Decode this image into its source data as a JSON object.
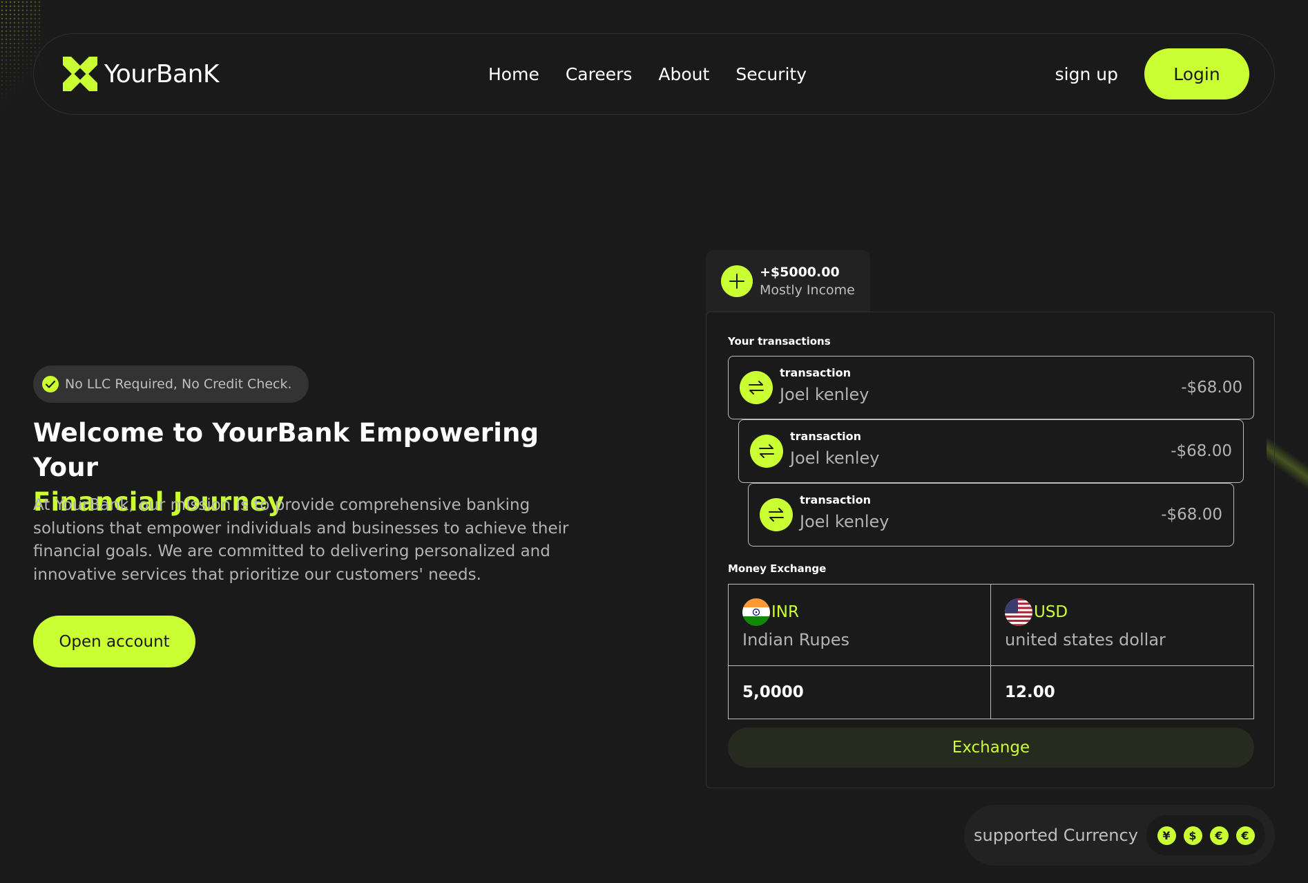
{
  "brand": {
    "name": "YourBanK",
    "accent": "#caff33"
  },
  "nav": {
    "links": [
      "Home",
      "Careers",
      "About",
      "Security"
    ],
    "signup": "sign up",
    "login": "Login"
  },
  "hero": {
    "badge": "No LLC Required, No Credit Check.",
    "title_line1": "Welcome to YourBank Empowering Your",
    "title_accent": "Financial Journey",
    "description": "At YourBank, our mission is to provide comprehensive banking solutions that empower individuals and businesses to achieve their financial goals. We are committed to delivering personalized and innovative services that prioritize our customers' needs.",
    "cta": "Open account"
  },
  "income": {
    "amount": "+$5000.00",
    "label": "Mostly Income"
  },
  "transactions": {
    "title": "Your transactions",
    "items": [
      {
        "label": "transaction",
        "name": "Joel kenley",
        "amount": "-$68.00"
      },
      {
        "label": "transaction",
        "name": "Joel kenley",
        "amount": "-$68.00"
      },
      {
        "label": "transaction",
        "name": "Joel kenley",
        "amount": "-$68.00"
      }
    ]
  },
  "exchange": {
    "title": "Money Exchange",
    "from": {
      "code": "INR",
      "name": "Indian Rupes",
      "value": "5,0000"
    },
    "to": {
      "code": "USD",
      "name": "united states dollar",
      "value": "12.00"
    },
    "button": "Exchange"
  },
  "supported": {
    "label": "supported Currency",
    "icons": [
      "¥",
      "$",
      "€",
      "€"
    ]
  }
}
